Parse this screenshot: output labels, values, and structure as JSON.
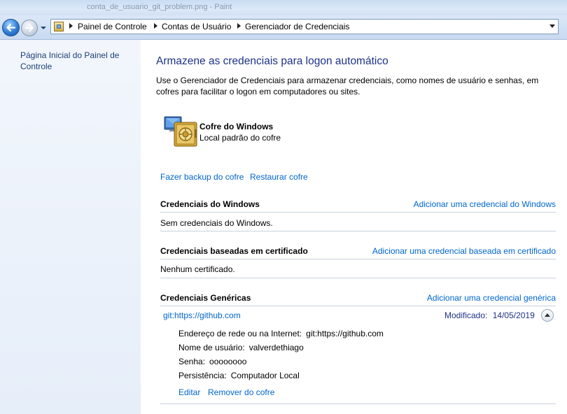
{
  "window": {
    "title": "conta_de_usuario_git_problem.png - Paint"
  },
  "address_bar": {
    "breadcrumbs": [
      "Painel de Controle",
      "Contas de Usuário",
      "Gerenciador de Credenciais"
    ]
  },
  "left_pane": {
    "home_link": "Página Inicial do Painel de Controle"
  },
  "main": {
    "heading": "Armazene as credenciais para logon automático",
    "description": "Use o Gerenciador de Credenciais para armazenar credenciais, como nomes de usuário e senhas, em cofres para facilitar o logon em computadores ou sites.",
    "vault": {
      "name": "Cofre do Windows",
      "location": "Local padrão do cofre"
    },
    "backup_link": "Fazer backup do cofre",
    "restore_link": "Restaurar cofre",
    "sections": {
      "windows": {
        "title": "Credenciais do Windows",
        "action": "Adicionar uma credencial do Windows",
        "empty": "Sem credenciais do Windows."
      },
      "certificate": {
        "title": "Credenciais baseadas em certificado",
        "action": "Adicionar uma credencial baseada em certificado",
        "empty": "Nenhum certificado."
      },
      "generic": {
        "title": "Credenciais Genéricas",
        "action": "Adicionar uma credencial genérica",
        "item": {
          "name": "git:https://github.com",
          "modified_label": "Modificado:",
          "modified_value": "14/05/2019",
          "details": [
            {
              "label": "Endereço de rede ou na Internet:",
              "value": "git:https://github.com"
            },
            {
              "label": "Nome de usuário:",
              "value": "valverdethiago"
            },
            {
              "label": "Senha:",
              "value": "oooooooo"
            },
            {
              "label": "Persistência:",
              "value": "Computador Local"
            }
          ],
          "edit_link": "Editar",
          "remove_link": "Remover do cofre"
        }
      }
    }
  },
  "colors": {
    "link": "#0066cc",
    "heading": "#1e3287",
    "left_pane": "#eef3fb"
  },
  "icons": [
    "back-arrow-icon",
    "forward-arrow-icon",
    "control-panel-icon",
    "windows-vault-icon",
    "collapse-chevron-icon"
  ]
}
